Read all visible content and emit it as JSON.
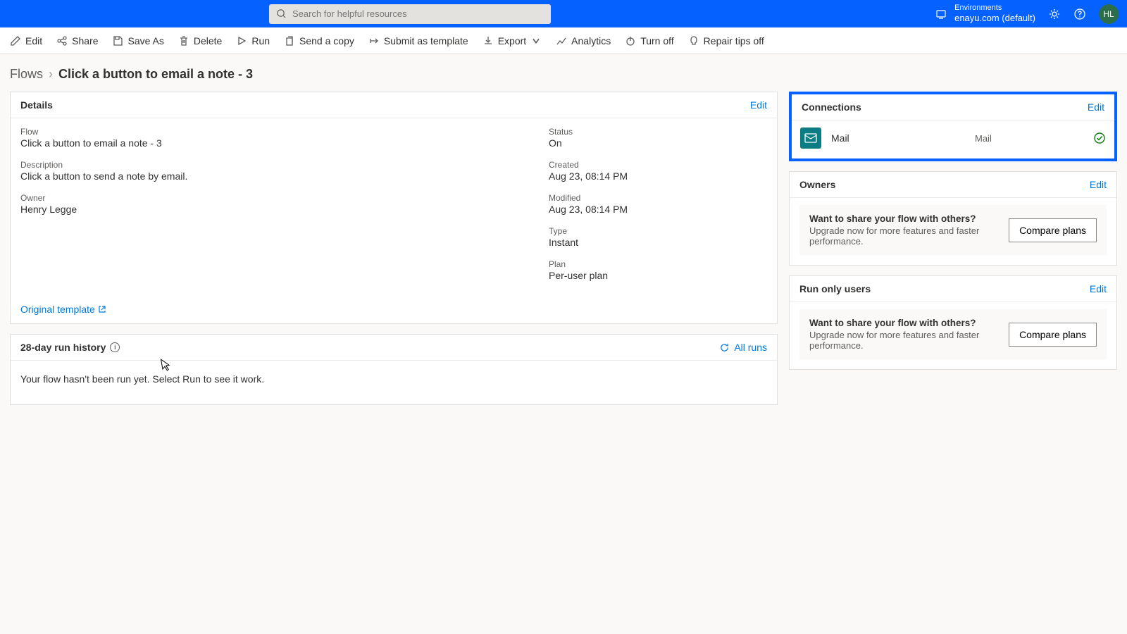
{
  "topbar": {
    "search_placeholder": "Search for helpful resources",
    "environments_label": "Environments",
    "environment_name": "enayu.com (default)",
    "avatar_initials": "HL"
  },
  "commands": {
    "edit": "Edit",
    "share": "Share",
    "save_as": "Save As",
    "delete": "Delete",
    "run": "Run",
    "send_copy": "Send a copy",
    "submit_template": "Submit as template",
    "export": "Export",
    "analytics": "Analytics",
    "turn_off": "Turn off",
    "repair_tips_off": "Repair tips off"
  },
  "breadcrumb": {
    "root": "Flows",
    "current": "Click a button to email a note - 3"
  },
  "details": {
    "title": "Details",
    "edit": "Edit",
    "flow_label": "Flow",
    "flow_value": "Click a button to email a note - 3",
    "description_label": "Description",
    "description_value": "Click a button to send a note by email.",
    "owner_label": "Owner",
    "owner_value": "Henry Legge",
    "status_label": "Status",
    "status_value": "On",
    "created_label": "Created",
    "created_value": "Aug 23, 08:14 PM",
    "modified_label": "Modified",
    "modified_value": "Aug 23, 08:14 PM",
    "type_label": "Type",
    "type_value": "Instant",
    "plan_label": "Plan",
    "plan_value": "Per-user plan",
    "original_template": "Original template"
  },
  "run_history": {
    "title": "28-day run history",
    "all_runs": "All runs",
    "empty_message": "Your flow hasn't been run yet. Select Run to see it work."
  },
  "connections": {
    "title": "Connections",
    "edit": "Edit",
    "item_name": "Mail",
    "item_type": "Mail"
  },
  "owners": {
    "title": "Owners",
    "edit": "Edit",
    "promo_q": "Want to share your flow with others?",
    "promo_d": "Upgrade now for more features and faster performance.",
    "promo_btn": "Compare plans"
  },
  "run_only": {
    "title": "Run only users",
    "edit": "Edit",
    "promo_q": "Want to share your flow with others?",
    "promo_d": "Upgrade now for more features and faster performance.",
    "promo_btn": "Compare plans"
  }
}
